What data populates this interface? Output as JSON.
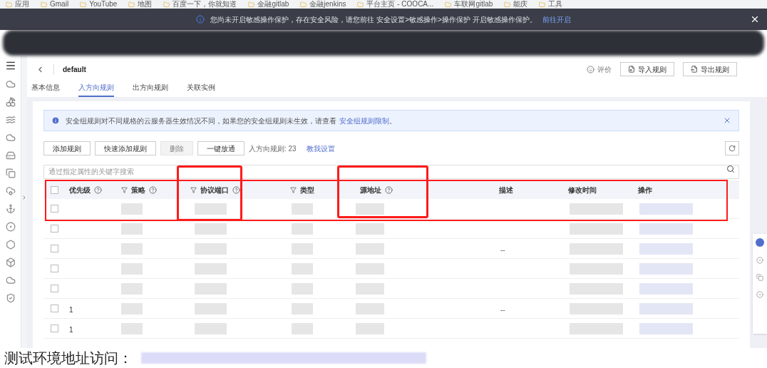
{
  "bookmarks": [
    "应用",
    "Gmail",
    "YouTube",
    "地图",
    "百度一下，你就知道",
    "金融gitlab",
    "金融jenkins",
    "平台主页 - COOCA...",
    "车联网gitlab",
    "能庆",
    "工具"
  ],
  "notice": {
    "text": "您尚未开启敏感操作保护，存在安全风险，请您前往 安全设置>敏感操作>操作保护 开启敏感操作保护。",
    "link": "前往开启"
  },
  "header": {
    "title": "default",
    "rate": "评价",
    "buttons": [
      "导入规则",
      "导出规则"
    ]
  },
  "tabs": [
    {
      "label": "基本信息",
      "selected": false
    },
    {
      "label": "入方向规则",
      "selected": true
    },
    {
      "label": "出方向规则",
      "selected": false
    },
    {
      "label": "关联实例",
      "selected": false
    }
  ],
  "alert": {
    "text": "安全组规则对不同规格的云服务器生效情况不同，如果您的安全组规则未生效，请查看",
    "link": "安全组规则限制",
    "end": "。"
  },
  "toolbar": {
    "buttons": [
      {
        "label": "添加规则",
        "disabled": false
      },
      {
        "label": "快速添加规则",
        "disabled": false
      },
      {
        "label": "删除",
        "disabled": true
      },
      {
        "label": "一键放通",
        "disabled": false
      }
    ],
    "count": "入方向规则: 23",
    "help_link": "教我设置"
  },
  "search": {
    "placeholder": "通过指定属性的关键字搜索"
  },
  "table": {
    "all_checked": false,
    "columns": [
      {
        "label": "优先级",
        "filter": false,
        "help": true
      },
      {
        "label": "策略",
        "filter": true,
        "help": true
      },
      {
        "label": "协议端口",
        "filter": true,
        "help": true
      },
      {
        "label": "类型",
        "filter": true,
        "help": false
      },
      {
        "label": "源地址",
        "filter": false,
        "help": true
      },
      {
        "label": "描述",
        "filter": false,
        "help": false
      },
      {
        "label": "修改时间",
        "filter": false,
        "help": false
      },
      {
        "label": "操作",
        "filter": false,
        "help": false
      }
    ],
    "rows": [
      {
        "checked": false,
        "priority": "",
        "description": ""
      },
      {
        "checked": false,
        "priority": "",
        "description": ""
      },
      {
        "checked": false,
        "priority": "",
        "description": "--"
      },
      {
        "checked": false,
        "priority": "",
        "description": ""
      },
      {
        "checked": false,
        "priority": "",
        "description": ""
      },
      {
        "checked": false,
        "priority": "1",
        "description": "--"
      },
      {
        "checked": false,
        "priority": "1",
        "description": ""
      }
    ]
  },
  "footer_text": "测试环境地址访问："
}
